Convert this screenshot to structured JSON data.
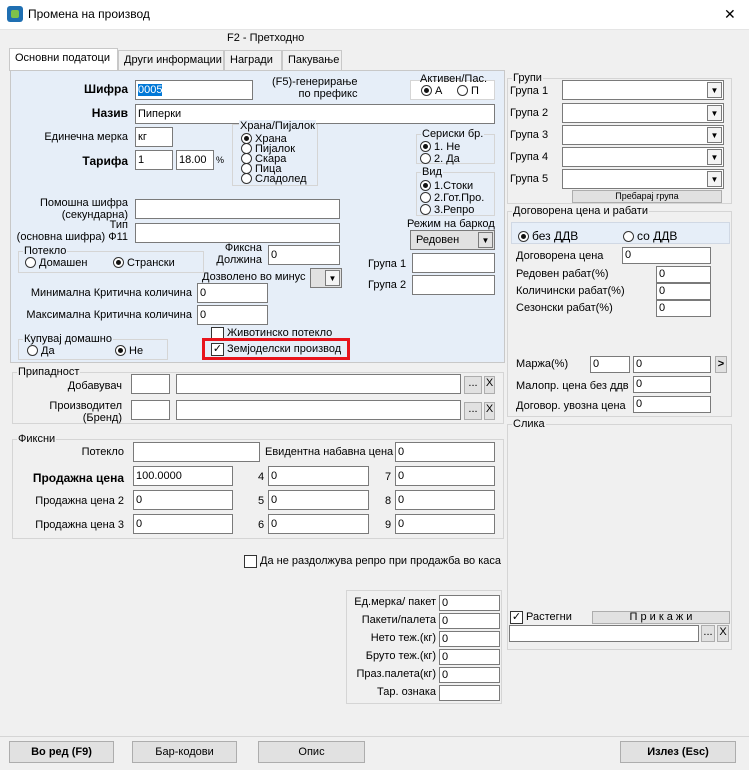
{
  "window": {
    "title": "Промена на производ",
    "close": "✕"
  },
  "header": "F2 - Претходно",
  "tabs": [
    "Основни податоци",
    "Други информации",
    "Награди",
    "Пакување"
  ],
  "main": {
    "sifra_label": "Шифра",
    "sifra_value": "0005",
    "gen_note": "(F5)-генерирање\nпо префикс",
    "aktiven_title": "Активен/Пас.",
    "aktiven_a": "А",
    "aktiven_p": "П",
    "naziv_label": "Назив",
    "naziv_value": "Пиперки",
    "merka_label": "Единечна мерка",
    "merka_value": "кг",
    "tarifa_label": "Тарифа",
    "tarifa_value": "1",
    "tarifa_pct": "18.00",
    "pct": "%",
    "hrana_title": "Храна/Пијалок",
    "hrana_opts": [
      "Храна",
      "Пијалок",
      "Скара",
      "Пица",
      "Сладолед"
    ],
    "serisk_title": "Сериски бр.",
    "serisk_opts": [
      "1. Не",
      "2. Да"
    ],
    "vid_title": "Вид",
    "vid_opts": [
      "1.Стоки",
      "2.Гот.Про.",
      "3.Репро"
    ],
    "barkod_label": "Режим на баркод",
    "barkod_value": "Редовен",
    "pomosna_label": "Помошна шифра\n(секундарна)",
    "tip_label": "Тип\n(основна шифра) Ф11",
    "poteklo_title": "Потекло",
    "poteklo_dom": "Домашен",
    "poteklo_str": "Странски",
    "fiksna_label": "Фиксна\nДолжина",
    "fiksna_value": "0",
    "dozv_label": "Дозволено во минус",
    "grupa1_label": "Група 1",
    "grupa2_label": "Група 2",
    "min_label": "Минимална Критична количина",
    "min_value": "0",
    "max_label": "Максимална Критична количина",
    "max_value": "0",
    "kupuvaj_title": "Купувај домашно",
    "da": "Да",
    "ne": "Не",
    "zivotinsko": "Животинско потекло",
    "zemjodelski": "Земјоделски производ",
    "pripadnost_title": "Припадност",
    "dobavuvac": "Добавувач",
    "proizvoditel": "Производител\n(Бренд)",
    "dots": "...",
    "x": "X"
  },
  "fiksni": {
    "title": "Фиксни",
    "poteklo": "Потекло",
    "evid": "Евидентна набавна цена",
    "evid_value": "0",
    "pc1": "Продажна цена",
    "pc1_value": "100.0000",
    "pc2": "Продажна цена 2",
    "pc2_value": "0",
    "pc3": "Продажна цена 3",
    "pc3_value": "0",
    "n4": "4",
    "n5": "5",
    "n6": "6",
    "n7": "7",
    "n8": "8",
    "n9": "9",
    "v4": "0",
    "v5": "0",
    "v6": "0",
    "v7": "0",
    "v8": "0",
    "v9": "0"
  },
  "ne_razdoluva": "Да не раздолжува репро при продажба во каса",
  "pack": {
    "labels": [
      "Ед.мерка/ пакет",
      "Пакети/палета",
      "Нето теж.(кг)",
      "Бруто теж.(кг)",
      "Праз.палета(кг)",
      "Тар. ознака"
    ],
    "values": [
      "0",
      "0",
      "0",
      "0",
      "0",
      ""
    ]
  },
  "grupi": {
    "title": "Групи",
    "labels": [
      "Група 1",
      "Група 2",
      "Група 3",
      "Група 4",
      "Група 5"
    ],
    "search": "Пребарај група"
  },
  "dogovorena": {
    "title": "Договорена цена и рабати",
    "bez": "без ДДВ",
    "so": "со ДДВ",
    "dog_cena": "Договорена цена",
    "dog_cena_v": "0",
    "redoven": "Редовен рабат(%)",
    "redoven_v": "0",
    "kolicinski": "Количински рабат(%)",
    "kolicinski_v": "0",
    "sezonski": "Сезонски рабат(%)",
    "sezonski_v": "0",
    "marza": "Маржа(%)",
    "marza_v1": "0",
    "marza_v2": "0",
    "gt": ">",
    "malop": "Малопр. цена без ддв",
    "malop_v": "0",
    "uvozna": "Договор. увозна цена",
    "uvozna_v": "0"
  },
  "slika": {
    "title": "Слика",
    "rastegni": "Растегни",
    "prikazi": "П р и к а ж и"
  },
  "footer": {
    "vo_red": "Во ред (F9)",
    "bar": "Бар-кодови",
    "opis": "Опис",
    "izlez": "Излез (Esc)"
  }
}
